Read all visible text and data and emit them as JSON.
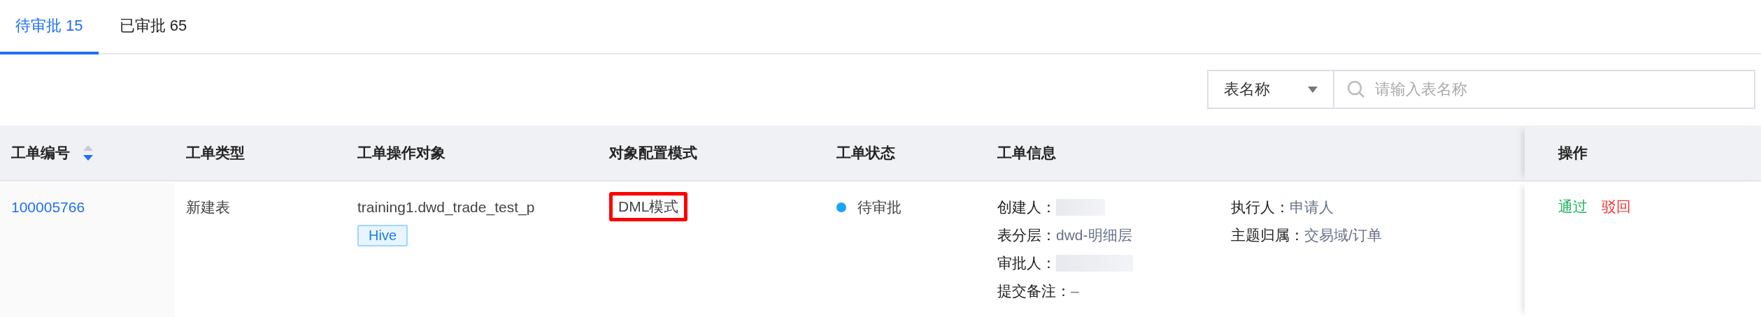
{
  "tabs": [
    {
      "label": "待审批 15",
      "selected": true
    },
    {
      "label": "已审批 65",
      "selected": false
    }
  ],
  "filter": {
    "field": "表名称",
    "placeholder": "请输入表名称"
  },
  "table": {
    "columns": [
      {
        "label": "工单编号",
        "sorted_descending": true
      },
      {
        "label": "工单类型"
      },
      {
        "label": "工单操作对象"
      },
      {
        "label": "对象配置模式"
      },
      {
        "label": "工单状态"
      },
      {
        "label": "工单信息"
      },
      {
        "label": "操作"
      }
    ],
    "rows": [
      {
        "id": "100005766",
        "type": "新建表",
        "object": "training1.dwd_trade_test_p",
        "engine": "Hive",
        "mode": {
          "text": "DML模式",
          "highlighted": true
        },
        "status": {
          "text": "待审批",
          "color": "#1aa4f9"
        },
        "info": [
          [
            {
              "label": "创建人：",
              "redacted": true
            },
            {
              "label": "表分层：",
              "value": "dwd-明细层"
            },
            {
              "label": "审批人：",
              "redacted": true
            },
            {
              "label": "提交备注：",
              "value": "–"
            }
          ],
          [
            {
              "label": "执行人：",
              "value": "申请人"
            },
            {
              "label": "主题归属：",
              "value": "交易域/订单"
            }
          ]
        ],
        "actions": [
          {
            "label": "通过",
            "kind": "approve"
          },
          {
            "label": "驳回",
            "kind": "reject"
          }
        ]
      }
    ]
  }
}
